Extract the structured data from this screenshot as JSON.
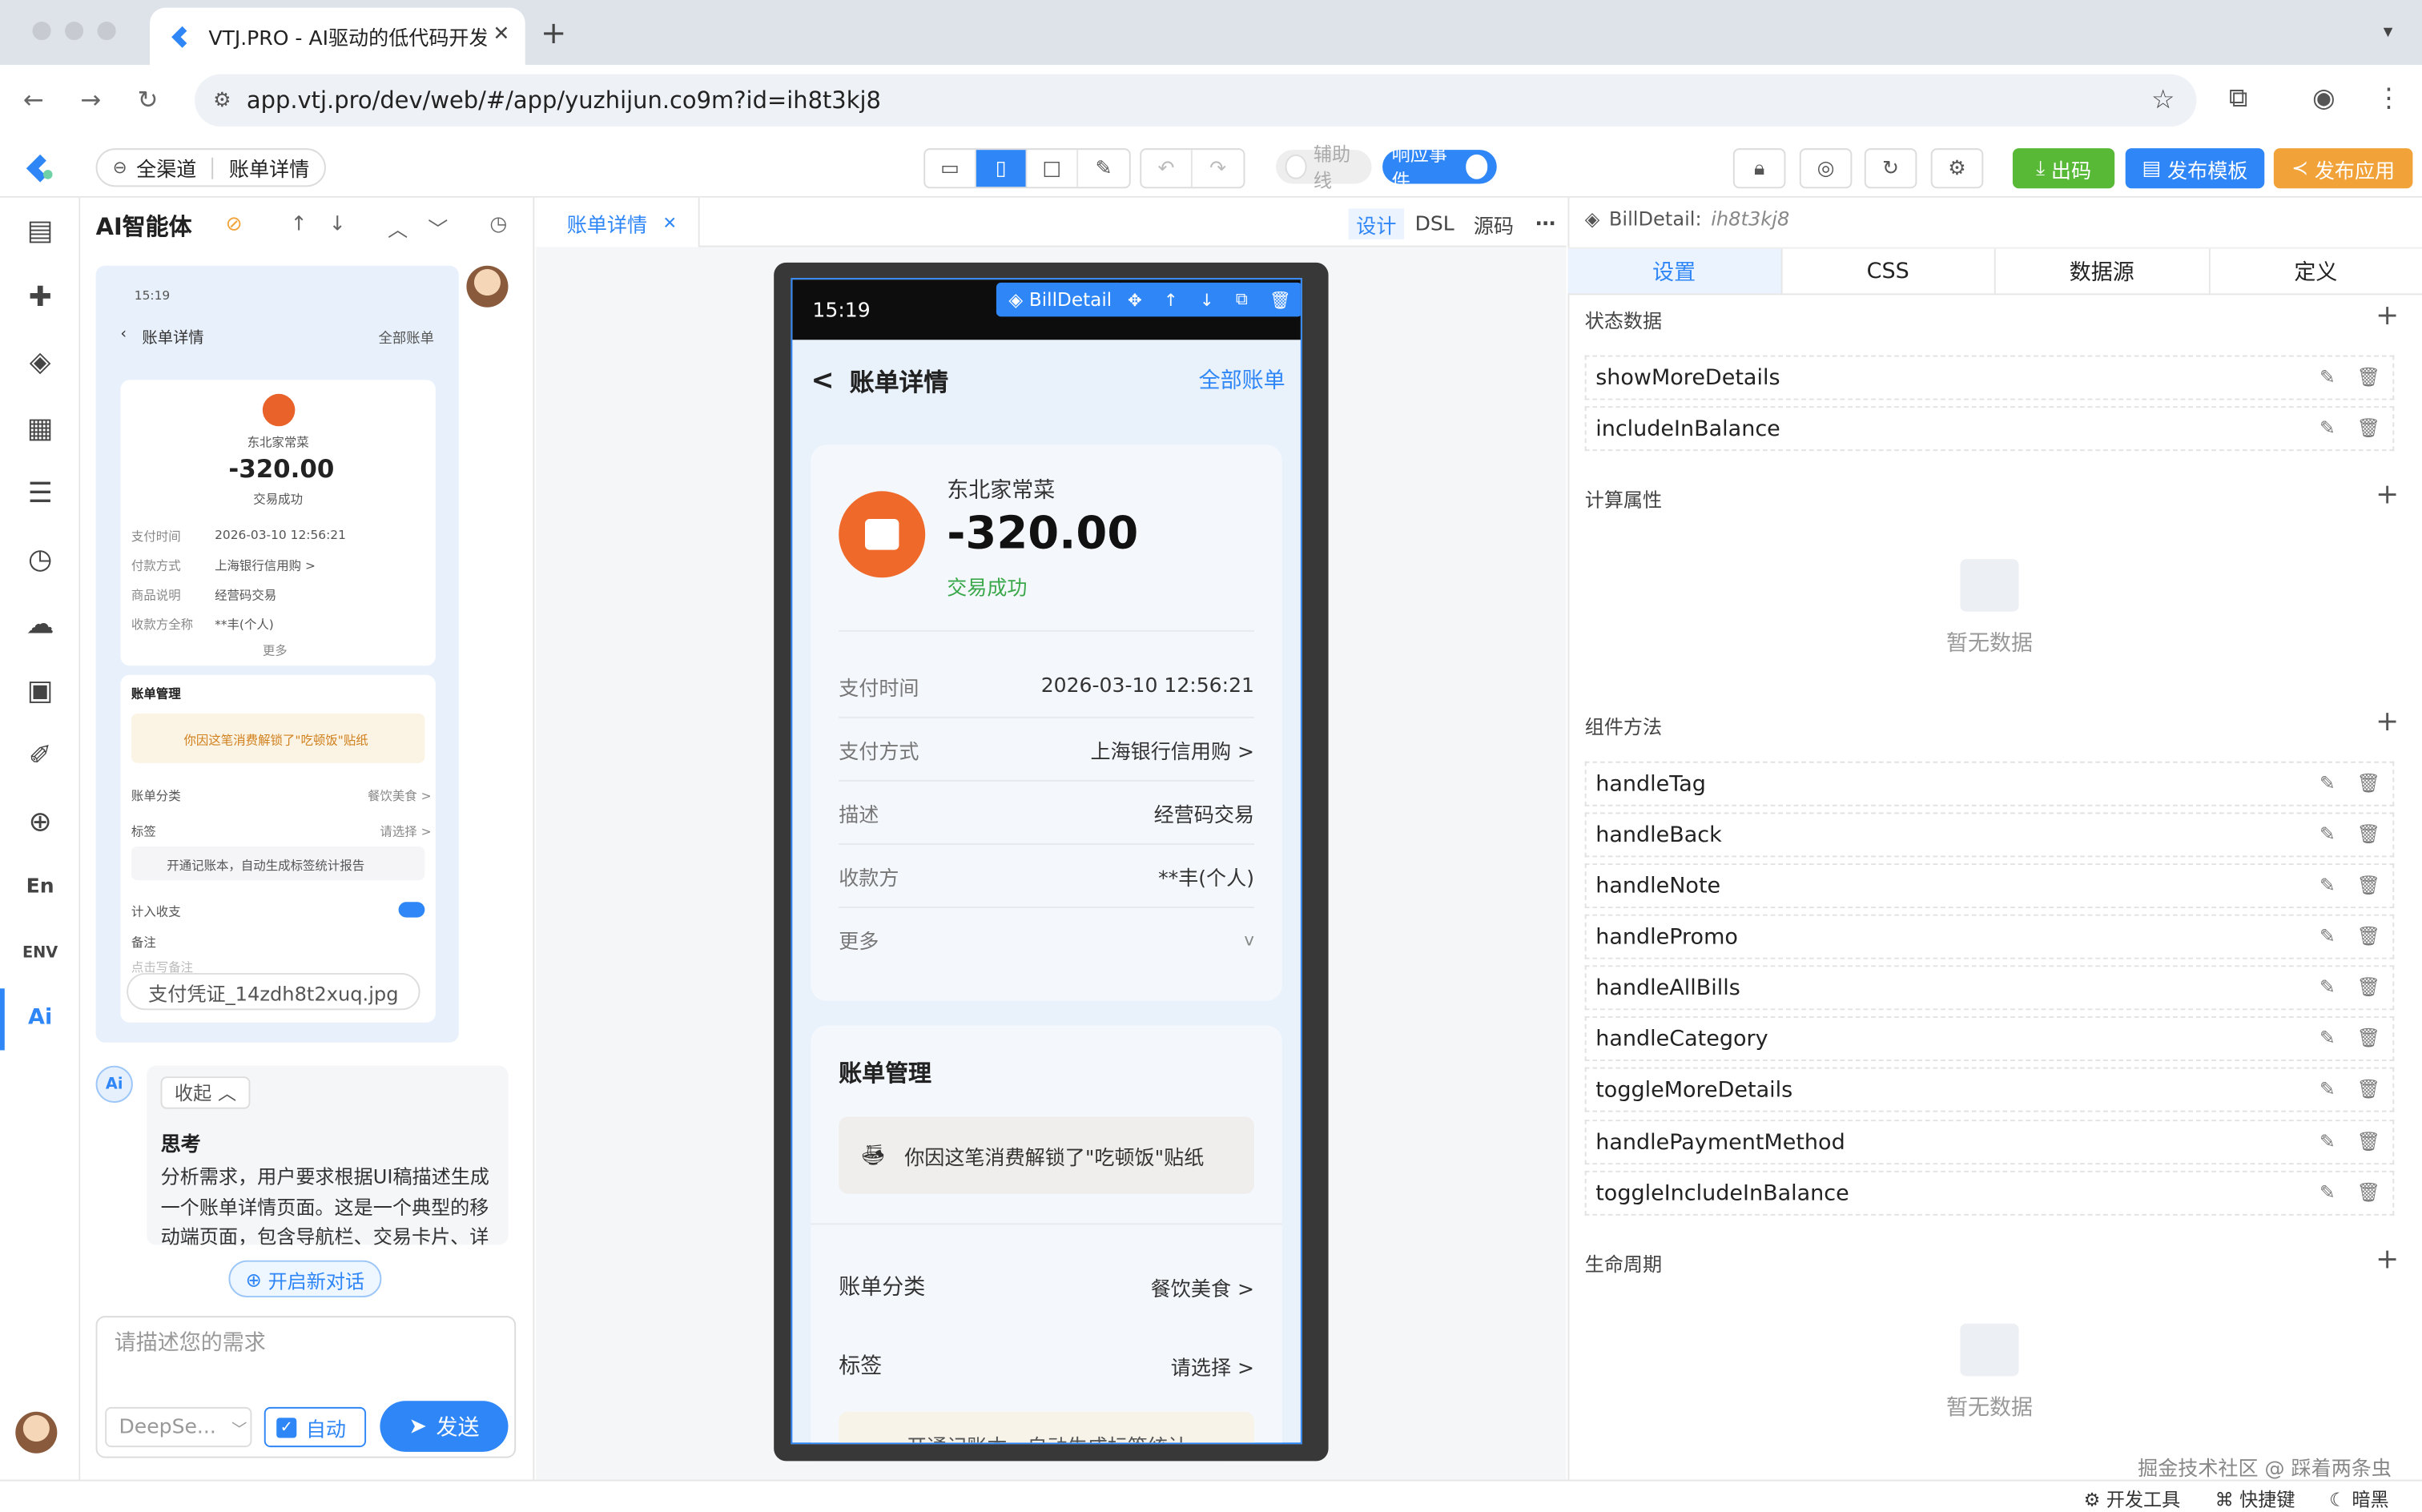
{
  "browser": {
    "tab_title": "VTJ.PRO - AI驱动的低代码开发",
    "url": "app.vtj.pro/dev/web/#/app/yuzhijun.co9m?id=ih8t3kj8"
  },
  "header": {
    "back_label": "全渠道",
    "page_label": "账单详情",
    "guide_label": "辅助线",
    "event_label": "响应事件",
    "btn_code": "出码",
    "btn_publish_tpl": "发布模板",
    "btn_publish_app": "发布应用"
  },
  "ai_panel": {
    "title": "AI智能体",
    "collapse_label": "收起",
    "think_title": "思考",
    "think_text": "分析需求，用户要求根据UI稿描述生成一个账单详情页面。这是一个典型的移动端页面，包含导航栏、交易卡片、详",
    "attachment": "支付凭证_14zdh8t2xuq.jpg",
    "new_chat": "开启新对话",
    "input_placeholder": "请描述您的需求",
    "model": "DeepSe...",
    "auto_label": "自动",
    "send_label": "发送",
    "thumb": {
      "time": "15:19",
      "title": "账单详情",
      "all": "全部账单",
      "merchant": "东北家常菜",
      "amount": "-320.00",
      "status": "交易成功",
      "rows": [
        [
          "支付时间",
          "2026-03-10 12:56:21"
        ],
        [
          "付款方式",
          "上海银行信用购 >"
        ],
        [
          "商品说明",
          "经营码交易"
        ],
        [
          "收款方全称",
          "**丰(个人)"
        ]
      ],
      "more": "更多",
      "manage": "账单管理",
      "unlock": "你因这笔消费解锁了\"吃顿饭\"贴纸",
      "category": "账单分类",
      "category_val": "餐饮美食 >",
      "tag": "标签",
      "tag_val": "请选择 >",
      "promo": "开通记账本，自动生成标签统计报告",
      "balance": "计入收支",
      "note": "备注",
      "note_ph": "点击写备注"
    }
  },
  "canvas": {
    "tab_label": "账单详情",
    "modes": [
      "设计",
      "DSL",
      "源码"
    ],
    "component_tag": "BillDetail",
    "phone": {
      "time": "15:19",
      "back": "<",
      "title": "账单详情",
      "all_bills": "全部账单",
      "merchant": "东北家常菜",
      "amount": "-320.00",
      "status": "交易成功",
      "rows": [
        {
          "k": "支付时间",
          "v": "2026-03-10 12:56:21"
        },
        {
          "k": "支付方式",
          "v": "上海银行信用购 >"
        },
        {
          "k": "描述",
          "v": "经营码交易"
        },
        {
          "k": "收款方",
          "v": "**丰(个人)"
        },
        {
          "k": "更多",
          "v": "v"
        }
      ],
      "manage_title": "账单管理",
      "unlock_text": "你因这笔消费解锁了\"吃顿饭\"贴纸",
      "category_k": "账单分类",
      "category_v": "餐饮美食 >",
      "tag_k": "标签",
      "tag_v": "请选择 >",
      "promo_partial": "开通记账本，自动生成标签统计"
    }
  },
  "right_panel": {
    "component": "BillDetail:",
    "component_id": "ih8t3kj8",
    "tabs": [
      "设置",
      "CSS",
      "数据源",
      "定义"
    ],
    "state_title": "状态数据",
    "state_items": [
      "showMoreDetails",
      "includeInBalance"
    ],
    "computed_title": "计算属性",
    "empty_text": "暂无数据",
    "methods_title": "组件方法",
    "methods": [
      "handleTag",
      "handleBack",
      "handleNote",
      "handlePromo",
      "handleAllBills",
      "handleCategory",
      "toggleMoreDetails",
      "handlePaymentMethod",
      "toggleIncludeInBalance"
    ],
    "lifecycle_title": "生命周期"
  },
  "footer": {
    "watermark": "掘金技术社区 @ 踩着两条虫",
    "devtools": "开发工具",
    "shortcuts": "快捷键",
    "dark": "暗黑"
  }
}
